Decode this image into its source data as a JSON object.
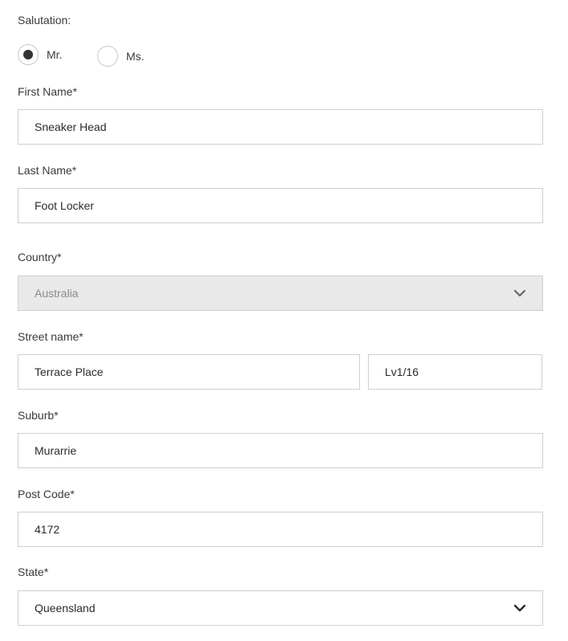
{
  "form": {
    "salutation": {
      "label": "Salutation:",
      "options": [
        {
          "label": "Mr.",
          "checked": true
        },
        {
          "label": "Ms.",
          "checked": false
        }
      ]
    },
    "first_name": {
      "label": "First Name*",
      "value": "Sneaker Head"
    },
    "last_name": {
      "label": "Last Name*",
      "value": "Foot Locker"
    },
    "country": {
      "label": "Country*",
      "value": "Australia",
      "disabled": true
    },
    "street": {
      "label": "Street name*",
      "name_value": "Terrace Place",
      "number_value": "Lv1/16"
    },
    "suburb": {
      "label": "Suburb*",
      "value": "Murarrie"
    },
    "post_code": {
      "label": "Post Code*",
      "value": "4172"
    },
    "state": {
      "label": "State*",
      "value": "Queensland"
    }
  },
  "icons": {
    "dropdown": "chevron-down-icon"
  },
  "colors": {
    "border": "#cfcfcf",
    "disabled_bg": "#e9e9e9",
    "text": "#2b2b2b"
  }
}
